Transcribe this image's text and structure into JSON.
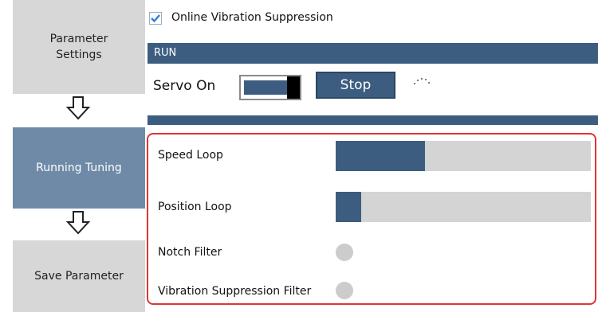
{
  "steps": [
    {
      "label": "Parameter Settings",
      "state": "inactive"
    },
    {
      "label": "Running Tuning",
      "state": "active"
    },
    {
      "label": "Save Parameter",
      "state": "inactive"
    }
  ],
  "option": {
    "label": "Online Vibration Suppression",
    "checked": true
  },
  "run": {
    "title": "RUN",
    "servo_label": "Servo On",
    "servo_on": true,
    "stop_label": "Stop"
  },
  "tuning": {
    "speed_loop": {
      "label": "Speed Loop",
      "level": 0.35
    },
    "position_loop": {
      "label": "Position Loop",
      "level": 0.1
    },
    "notch_filter": {
      "label": "Notch Filter",
      "status": "off"
    },
    "vibration_filter": {
      "label": "Vibration Suppression Filter",
      "status": "off"
    }
  },
  "colors": {
    "accent": "#3c5d80",
    "active_step": "#6f8aa6",
    "inactive_step": "#d7d7d7",
    "highlight_border": "#e03434",
    "indicator_off": "#cccccc",
    "checkbox_check": "#2b7fd8"
  },
  "icons": [
    "check-icon",
    "down-arrow-icon",
    "loading-spinner-icon",
    "indicator-dot-icon"
  ]
}
